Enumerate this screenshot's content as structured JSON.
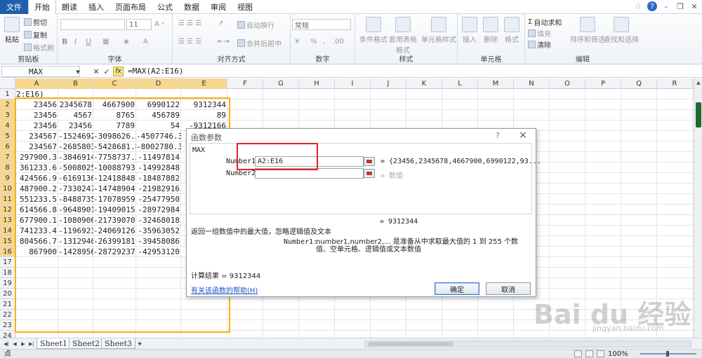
{
  "ribbon_tabs": [
    "文件",
    "开始",
    "朗读",
    "插入",
    "页面布局",
    "公式",
    "数据",
    "审阅",
    "视图"
  ],
  "active_tab": "开始",
  "ribbon": {
    "clipboard": {
      "paste": "粘贴",
      "cut": "剪切",
      "copy": "复制",
      "format_painter": "格式刷",
      "label": "剪贴板"
    },
    "font": {
      "size": "11",
      "bold": "B",
      "italic": "I",
      "underline": "U",
      "label": "字体"
    },
    "alignment": {
      "wrap": "自动换行",
      "merge": "合并后居中",
      "label": "对齐方式"
    },
    "number": {
      "format": "常规",
      "percent": "%",
      "comma": ",",
      "label": "数字"
    },
    "styles": {
      "conditional": "条件格式",
      "table": "套用表格格式",
      "cell_styles": "单元格样式",
      "label": "样式"
    },
    "cells": {
      "insert": "插入",
      "delete": "删除",
      "format": "格式",
      "label": "单元格"
    },
    "editing": {
      "autosum": "自动求和",
      "fill": "填充",
      "clear": "清除",
      "sort": "排序和筛选",
      "find": "查找和选择",
      "label": "编辑"
    }
  },
  "namebox": "MAX",
  "formula": "=MAX(A2:E16)",
  "columns": [
    "A",
    "B",
    "C",
    "D",
    "E",
    "F",
    "G",
    "H",
    "I",
    "J",
    "K",
    "L",
    "M",
    "N",
    "O",
    "P",
    "Q",
    "R"
  ],
  "rows": [
    "1",
    "2",
    "3",
    "4",
    "5",
    "6",
    "7",
    "8",
    "9",
    "10",
    "11",
    "12",
    "13",
    "14",
    "15",
    "16",
    "17",
    "18",
    "19",
    "20",
    "21",
    "22",
    "23",
    "24"
  ],
  "cell_a1": "2:E16)",
  "data_rows": [
    [
      "23456",
      "2345678",
      "4667900",
      "6990122",
      "9312344"
    ],
    [
      "23456",
      "4567",
      "8765",
      "456789",
      "89"
    ],
    [
      "23456",
      "23456",
      "7789",
      "54",
      "-9312166"
    ],
    [
      "234567",
      "-1524692",
      "-3098626.3",
      "-4507746.3",
      ""
    ],
    [
      "234567",
      "-2685803",
      "-5428681.8",
      "-8002780.3",
      ""
    ],
    [
      "297900.3",
      "-3846914",
      "-7758737.3",
      "-11497814",
      ""
    ],
    [
      "361233.6",
      "-5008025",
      "-10088793",
      "-14992848",
      ""
    ],
    [
      "424566.9",
      "-6169136",
      "-12418848",
      "-18487882",
      ""
    ],
    [
      "487900.2",
      "-7330247",
      "-14748904",
      "-21982916",
      ""
    ],
    [
      "551233.5",
      "-8488735",
      "-17078959",
      "-25477950",
      ""
    ],
    [
      "614566.8",
      "-9648901",
      "-19409015",
      "-28972984",
      ""
    ],
    [
      "677900.1",
      "-10809068",
      "-21739070",
      "-32468018",
      ""
    ],
    [
      "741233.4",
      "-11969234",
      "-24069126",
      "-35963052",
      ""
    ],
    [
      "804566.7",
      "-13129401",
      "-26399181",
      "-39458086",
      ""
    ],
    [
      "867900",
      "-14289567",
      "-28729237",
      "-42953120",
      ""
    ]
  ],
  "sheets": [
    "Sheet1",
    "Sheet2",
    "Sheet3"
  ],
  "status": {
    "mode": "点",
    "zoom": "100%"
  },
  "dialog": {
    "title": "函数参数",
    "help_q": "?",
    "function_name": "MAX",
    "arg1_label": "Number1",
    "arg1_value": "A2:E16",
    "arg1_result": "= {23456,2345678,4667900,6990122,93...",
    "arg2_label": "Number2",
    "arg2_result": "= 数值",
    "formula_result": "= 9312344",
    "description": "返回一组数值中的最大值，忽略逻辑值及文本",
    "arg_name": "Number1:",
    "arg_description": "number1,number2,... 是准备从中求取最大值的 1 到 255 个数值、空单元格、逻辑值或文本数值",
    "calc_result": "计算结果 = 9312344",
    "help_link": "有关该函数的帮助(H)",
    "ok": "确定",
    "cancel": "取消"
  },
  "watermark": {
    "brand": "Bai du 经验",
    "url": "jingyan.baidu.com"
  },
  "colors": {
    "file_tab": "#1f5faa",
    "selection_border": "#f5b300",
    "highlight_box": "#e52222"
  }
}
